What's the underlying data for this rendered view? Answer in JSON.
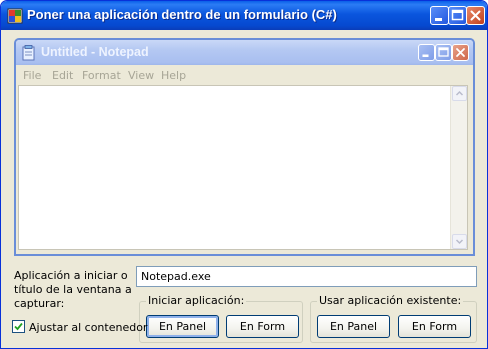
{
  "window": {
    "title": "Poner una aplicación dentro de un formulario (C#)"
  },
  "embedded": {
    "title": "Untitled - Notepad",
    "menu": [
      "File",
      "Edit",
      "Format",
      "View",
      "Help"
    ]
  },
  "form": {
    "label_lines": [
      "Aplicación a iniciar o",
      "título de la ventana a",
      "capturar:"
    ],
    "input_value": "Notepad.exe",
    "group_start": {
      "legend": "Iniciar aplicación:",
      "panel_button": "En Panel",
      "form_button": "En Form"
    },
    "group_existing": {
      "legend": "Usar aplicación existente:",
      "panel_button": "En Panel",
      "form_button": "En Form"
    },
    "checkbox": {
      "label": "Ajustar al contenedor",
      "checked": true
    }
  },
  "colors": {
    "titlebar": "#0a56de",
    "face": "#ece9d8",
    "notepad_titlebar": "#a9bff0"
  }
}
